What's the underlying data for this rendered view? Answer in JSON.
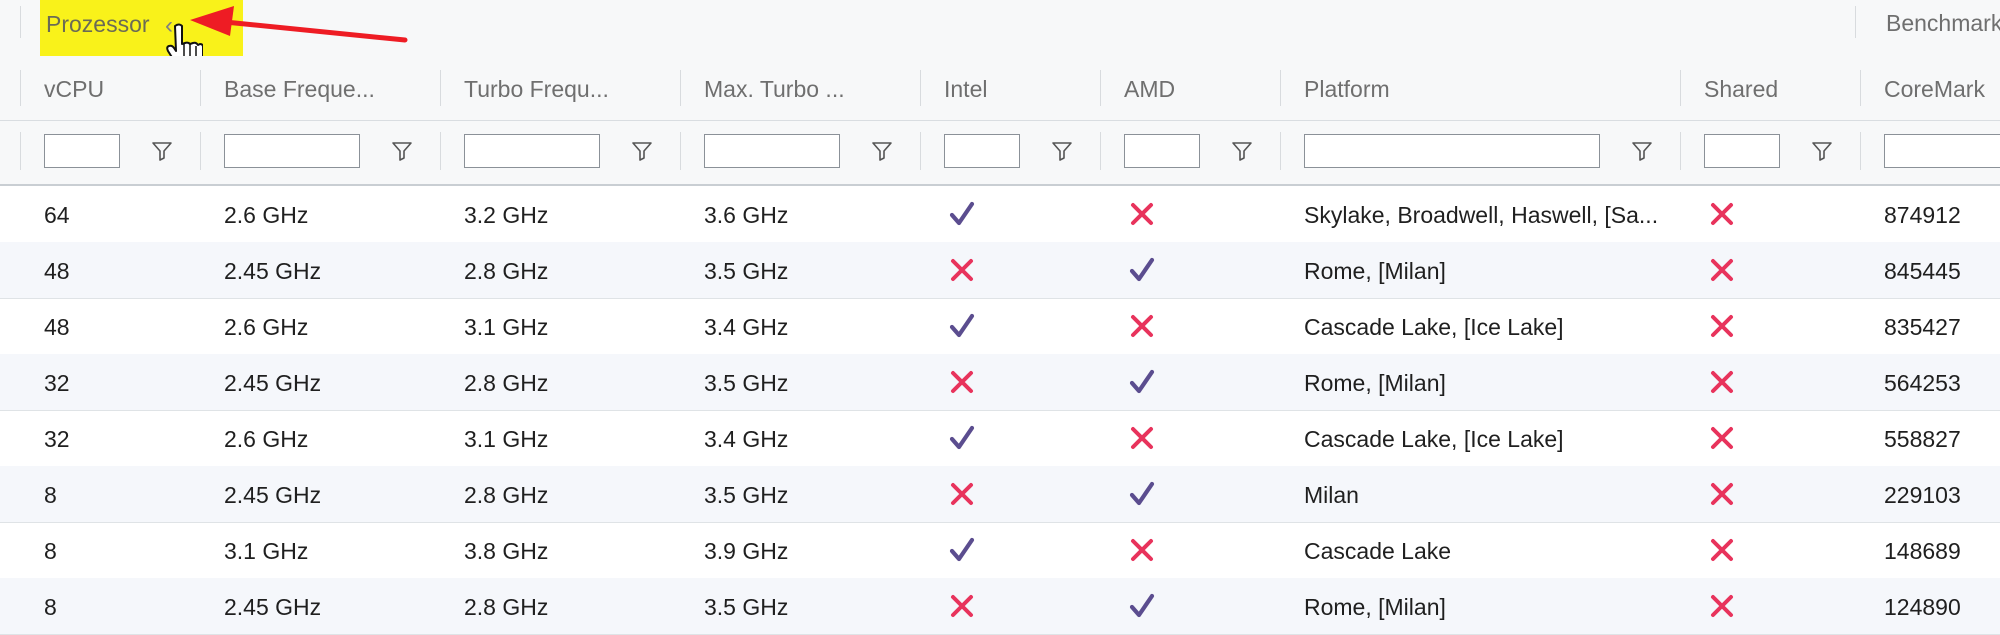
{
  "groups": {
    "processor": "Prozessor",
    "benchmark": "Benchmark"
  },
  "columns": [
    "vCPU",
    "Base Freque...",
    "Turbo Frequ...",
    "Max. Turbo ...",
    "Intel",
    "AMD",
    "Platform",
    "Shared",
    "CoreMark"
  ],
  "colors": {
    "highlight": "#f9f21a",
    "arrow": "#ee1c24",
    "check": "#5b4d8f",
    "cross": "#e8335c"
  },
  "rows": [
    {
      "vcpu": "64",
      "base": "2.6 GHz",
      "turbo": "3.2 GHz",
      "max": "3.6 GHz",
      "intel": true,
      "amd": false,
      "platform": "Skylake, Broadwell, Haswell, [Sa...",
      "shared": false,
      "coremark": "874912"
    },
    {
      "vcpu": "48",
      "base": "2.45 GHz",
      "turbo": "2.8 GHz",
      "max": "3.5 GHz",
      "intel": false,
      "amd": true,
      "platform": "Rome, [Milan]",
      "shared": false,
      "coremark": "845445"
    },
    {
      "vcpu": "48",
      "base": "2.6 GHz",
      "turbo": "3.1 GHz",
      "max": "3.4 GHz",
      "intel": true,
      "amd": false,
      "platform": "Cascade Lake, [Ice Lake]",
      "shared": false,
      "coremark": "835427"
    },
    {
      "vcpu": "32",
      "base": "2.45 GHz",
      "turbo": "2.8 GHz",
      "max": "3.5 GHz",
      "intel": false,
      "amd": true,
      "platform": "Rome, [Milan]",
      "shared": false,
      "coremark": "564253"
    },
    {
      "vcpu": "32",
      "base": "2.6 GHz",
      "turbo": "3.1 GHz",
      "max": "3.4 GHz",
      "intel": true,
      "amd": false,
      "platform": "Cascade Lake, [Ice Lake]",
      "shared": false,
      "coremark": "558827"
    },
    {
      "vcpu": "8",
      "base": "2.45 GHz",
      "turbo": "2.8 GHz",
      "max": "3.5 GHz",
      "intel": false,
      "amd": true,
      "platform": "Milan",
      "shared": false,
      "coremark": "229103"
    },
    {
      "vcpu": "8",
      "base": "3.1 GHz",
      "turbo": "3.8 GHz",
      "max": "3.9 GHz",
      "intel": true,
      "amd": false,
      "platform": "Cascade Lake",
      "shared": false,
      "coremark": "148689"
    },
    {
      "vcpu": "8",
      "base": "2.45 GHz",
      "turbo": "2.8 GHz",
      "max": "3.5 GHz",
      "intel": false,
      "amd": true,
      "platform": "Rome, [Milan]",
      "shared": false,
      "coremark": "124890"
    }
  ]
}
